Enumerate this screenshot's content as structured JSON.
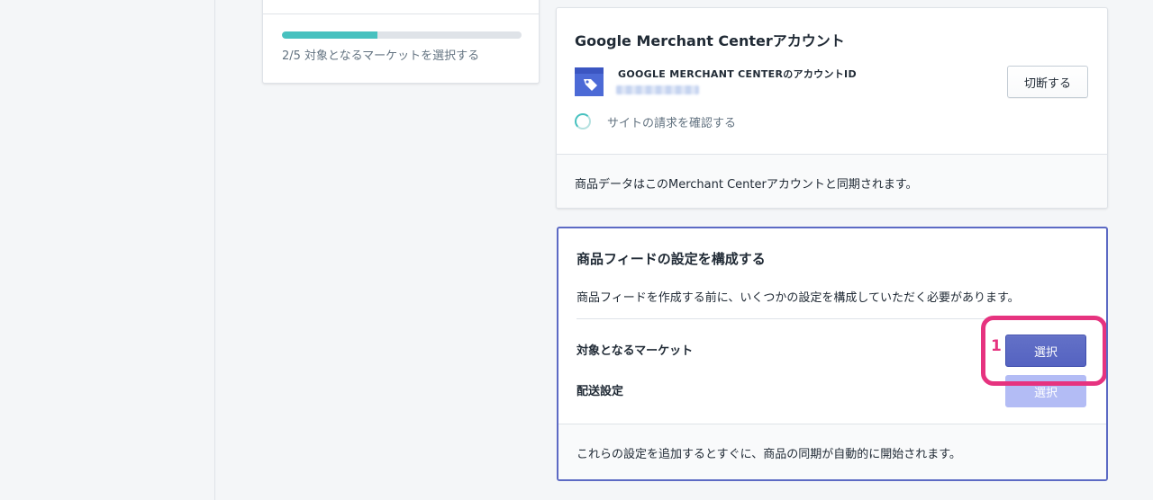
{
  "progress": {
    "fraction": 0.4,
    "text": "2/5  対象となるマーケットを選択する"
  },
  "gmc_card": {
    "title": "Google Merchant Centerアカウント",
    "account_label": "GOOGLE MERCHANT CENTERのアカウントID",
    "disconnect_label": "切断する",
    "verify_text": "サイトの請求を確認する",
    "footer_text": "商品データはこのMerchant Centerアカウントと同期されます。"
  },
  "feed_card": {
    "title": "商品フィードの設定を構成する",
    "description": "商品フィードを作成する前に、いくつかの設定を構成していただく必要があります。",
    "market_label": "対象となるマーケット",
    "shipping_label": "配送設定",
    "select_label": "選択",
    "highlight_number": "1",
    "footer_text": "これらの設定を追加するとすぐに、商品の同期が自動的に開始されます。"
  },
  "colors": {
    "progress_fill": "#47c1bf",
    "primary_button": "#5c6ac4",
    "disabled_button": "#b3bcf5",
    "highlight": "#e6337f",
    "tag_icon_bg": "#4c6ad6"
  },
  "icons": [
    "tag-icon",
    "spinner-icon"
  ]
}
